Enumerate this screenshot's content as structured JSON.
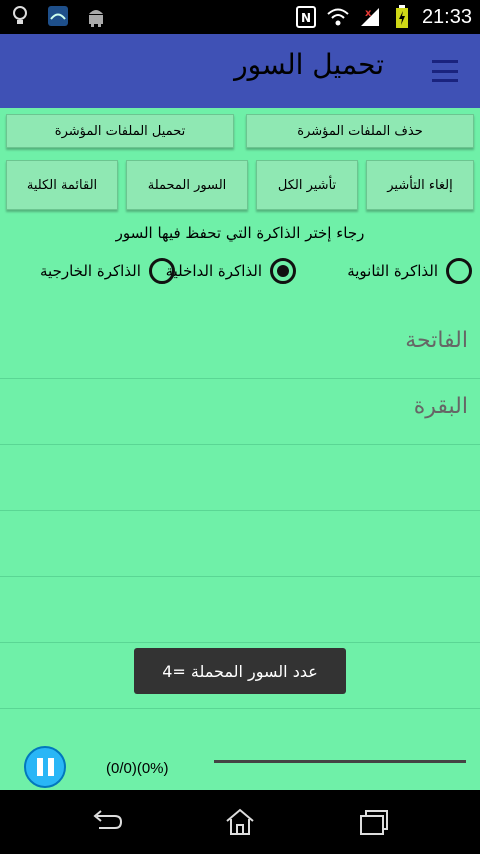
{
  "status_bar": {
    "time": "21:33",
    "left_icons": [
      "lightbulb-icon",
      "quran-app-icon",
      "android-icon"
    ],
    "right_icons": [
      "nfc-icon",
      "wifi-icon",
      "signal-icon",
      "battery-icon"
    ]
  },
  "app_bar": {
    "title": "تحميل السور",
    "menu_icon": "hamburger-menu-icon"
  },
  "actions": {
    "delete_marked": "حذف الملفات المؤشرة",
    "download_marked": "تحميل الملفات المؤشرة",
    "unmark": "إلغاء التأشير",
    "mark_all": "تأشير الكل",
    "downloaded_surahs": "السور المحملة",
    "full_list": "القائمة الكلية"
  },
  "storage": {
    "prompt": "رجاء إختر الذاكرة التي تحفظ فيها السور",
    "options": [
      {
        "label": "الذاكرة الثانوية",
        "selected": false
      },
      {
        "label": "الذاكرة الداخلية",
        "selected": true
      },
      {
        "label": "الذاكرة الخارجية",
        "selected": false
      }
    ]
  },
  "surah_list": [
    "الفاتحة",
    "البقرة",
    "",
    "",
    "",
    ""
  ],
  "toast": "عدد السور المحملة =4",
  "player": {
    "progress_text": "(0/0)(0%)",
    "progress": 0,
    "button_icon": "pause-icon"
  },
  "nav_bar": {
    "back_icon": "back-icon",
    "home_icon": "home-icon",
    "recents_icon": "recents-icon"
  }
}
